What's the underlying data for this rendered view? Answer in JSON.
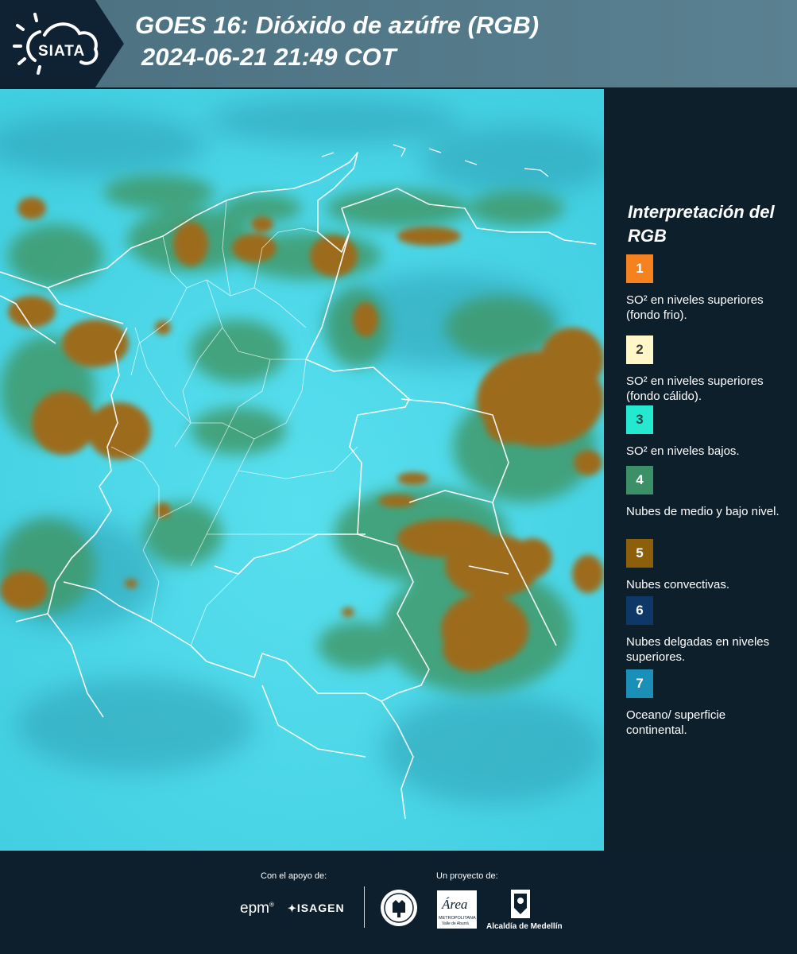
{
  "header": {
    "logo_text": "SIATA",
    "title_line1": "GOES 16: Dióxido de azúfre (RGB)",
    "title_line2": "2024-06-21 21:49 COT"
  },
  "legend": {
    "title": "Interpretación del RGB",
    "items": [
      {
        "number": "1",
        "color": "#f5821f",
        "text_color": "#ffffff",
        "text": "SO² en niveles superiores (fondo frio)."
      },
      {
        "number": "2",
        "color": "#fff7c8",
        "text_color": "#3a3a3a",
        "text": "SO² en niveles superiores (fondo cálido)."
      },
      {
        "number": "3",
        "color": "#25e8d0",
        "text_color": "#1f4a4a",
        "text": "SO² en niveles bajos."
      },
      {
        "number": "4",
        "color": "#3b9068",
        "text_color": "#ffffff",
        "text": "Nubes de medio y bajo nivel."
      },
      {
        "number": "5",
        "color": "#8e5f0b",
        "text_color": "#ffffff",
        "text": "Nubes convectivas."
      },
      {
        "number": "6",
        "color": "#0d3868",
        "text_color": "#ffffff",
        "text": "Nubes delgadas en niveles superiores."
      },
      {
        "number": "7",
        "color": "#1a8fb8",
        "text_color": "#ffffff",
        "text": "Oceano/ superficie continental."
      }
    ]
  },
  "footer": {
    "support_label": "Con el apoyo de:",
    "project_label": "Un proyecto de:",
    "sponsor1": "epm",
    "sponsor2": "ISAGEN",
    "partner_area": "Área",
    "partner_area_sub": "METROPOLITANA",
    "partner_area_sub2": "Valle de Aburrá",
    "partner_alcaldia": "Alcaldía de Medellín"
  }
}
